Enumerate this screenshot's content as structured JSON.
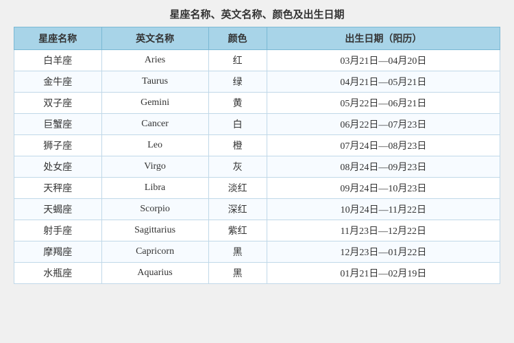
{
  "title": "星座名称、英文名称、颜色及出生日期",
  "headers": {
    "name_cn": "星座名称",
    "name_en": "英文名称",
    "color": "颜色",
    "birthdate": "出生日期（阳历）"
  },
  "rows": [
    {
      "name_cn": "白羊座",
      "name_en": "Aries",
      "color": "红",
      "birthdate": "03月21日—04月20日"
    },
    {
      "name_cn": "金牛座",
      "name_en": "Taurus",
      "color": "绿",
      "birthdate": "04月21日—05月21日"
    },
    {
      "name_cn": "双子座",
      "name_en": "Gemini",
      "color": "黄",
      "birthdate": "05月22日—06月21日"
    },
    {
      "name_cn": "巨蟹座",
      "name_en": "Cancer",
      "color": "白",
      "birthdate": "06月22日—07月23日"
    },
    {
      "name_cn": "狮子座",
      "name_en": "Leo",
      "color": "橙",
      "birthdate": "07月24日—08月23日"
    },
    {
      "name_cn": "处女座",
      "name_en": "Virgo",
      "color": "灰",
      "birthdate": "08月24日—09月23日"
    },
    {
      "name_cn": "天秤座",
      "name_en": "Libra",
      "color": "淡红",
      "birthdate": "09月24日—10月23日"
    },
    {
      "name_cn": "天蝎座",
      "name_en": "Scorpio",
      "color": "深红",
      "birthdate": "10月24日—11月22日"
    },
    {
      "name_cn": "射手座",
      "name_en": "Sagittarius",
      "color": "紫红",
      "birthdate": "11月23日—12月22日"
    },
    {
      "name_cn": "摩羯座",
      "name_en": "Capricorn",
      "color": "黑",
      "birthdate": "12月23日—01月22日"
    },
    {
      "name_cn": "水瓶座",
      "name_en": "Aquarius",
      "color": "黑",
      "birthdate": "01月21日—02月19日"
    }
  ]
}
